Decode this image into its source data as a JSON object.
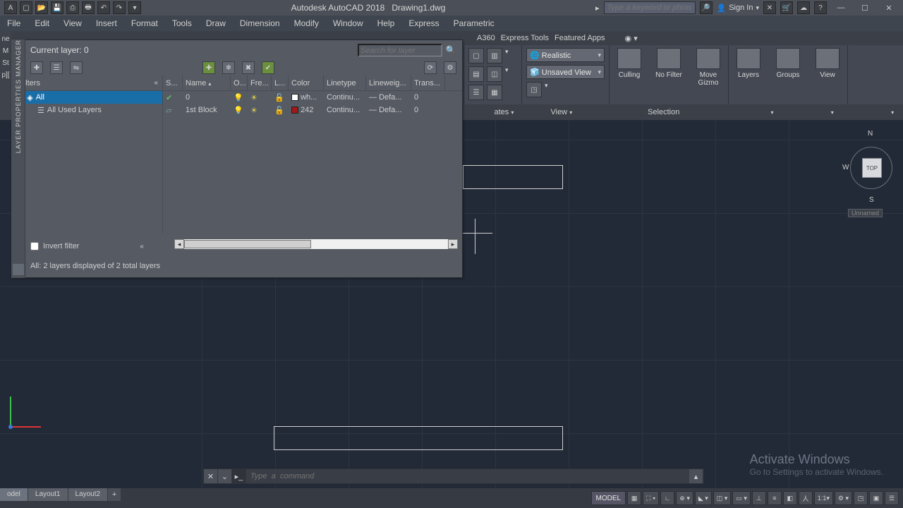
{
  "title": {
    "app": "Autodesk AutoCAD 2018",
    "doc": "Drawing1.dwg"
  },
  "searchPlaceholder": "Type a keyword or phrase",
  "signin": "Sign In",
  "menus": [
    "File",
    "Edit",
    "View",
    "Insert",
    "Format",
    "Tools",
    "Draw",
    "Dimension",
    "Modify",
    "Window",
    "Help",
    "Express",
    "Parametric"
  ],
  "ribbon": {
    "tabs": [
      "A360",
      "Express Tools",
      "Featured Apps"
    ],
    "visualStyle": "Realistic",
    "view": "Unsaved View",
    "panels": {
      "culling": "Culling",
      "nofilter": "No Filter",
      "movegizmo": {
        "l1": "Move",
        "l2": "Gizmo"
      },
      "layers": "Layers",
      "groups": "Groups",
      "viewbtn": "View",
      "selection": "Selection"
    },
    "bot": {
      "ates": "ates",
      "view": "View"
    }
  },
  "leftResid": [
    "ne",
    "M",
    "St",
    "p]["
  ],
  "layerPanel": {
    "current": "Current layer: 0",
    "searchPlaceholder": "Search for layer",
    "filters": "Filters",
    "tree": {
      "all": "All",
      "used": "All Used Layers"
    },
    "cols": [
      "S...",
      "Name",
      "O...",
      "Fre...",
      "L...",
      "Color",
      "Linetype",
      "Lineweig...",
      "Trans..."
    ],
    "rows": [
      {
        "name": "0",
        "color": "wh...",
        "swatch": "#ffffff",
        "ltype": "Continu...",
        "lweight": "Defa...",
        "trans": "0"
      },
      {
        "name": "1st Block",
        "color": "242",
        "swatch": "#a01818",
        "ltype": "Continu...",
        "lweight": "Defa...",
        "trans": "0"
      }
    ],
    "invert": "Invert filter",
    "status": "All: 2 layers displayed of 2 total layers",
    "vtitle": "LAYER PROPERTIES MANAGER"
  },
  "viewcube": {
    "n": "N",
    "s": "S",
    "w": "W",
    "top": "TOP",
    "label": "Unnamed"
  },
  "watermark": {
    "title": "Activate Windows",
    "sub": "Go to Settings to activate Windows."
  },
  "cmd": {
    "placeholder": "Type  a  command"
  },
  "layoutTabs": [
    "odel",
    "Layout1",
    "Layout2"
  ],
  "status": {
    "model": "MODEL",
    "scale": "1:1"
  }
}
